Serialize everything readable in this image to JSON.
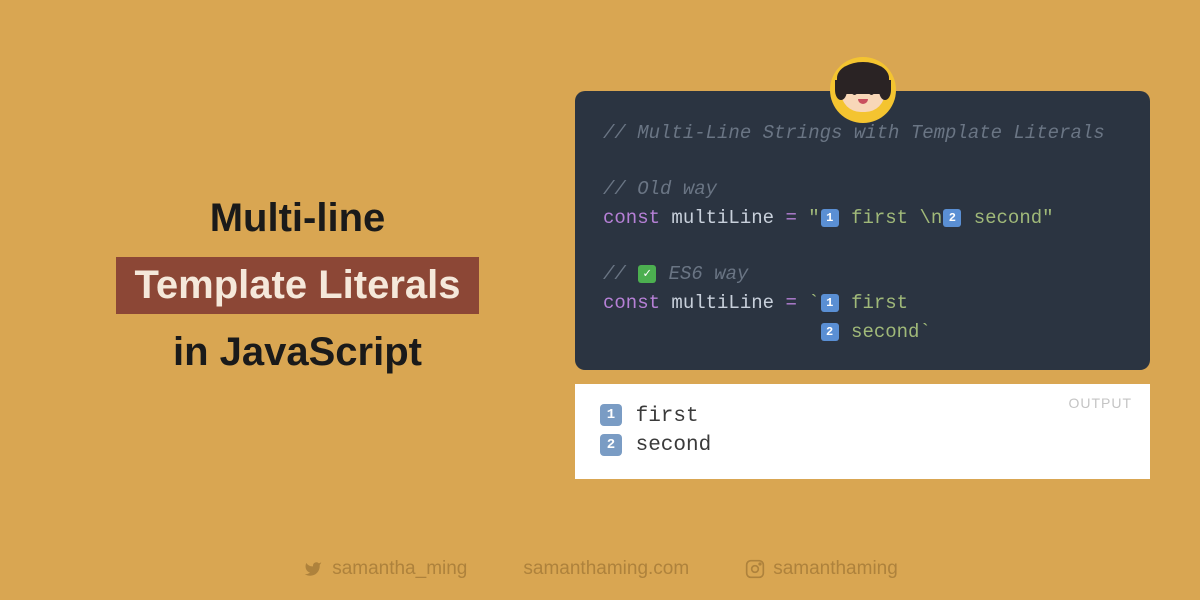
{
  "title": {
    "line1": "Multi-line",
    "highlight": "Template Literals",
    "line3": "in JavaScript"
  },
  "code": {
    "comment1": "// Multi-Line Strings with Template Literals",
    "comment2": "// Old way",
    "keyword": "const",
    "varname": "multiLine",
    "equals": "=",
    "string_open_dq": "\"",
    "string_first": " first ",
    "string_newline": "\\n",
    "string_second": " second",
    "string_close_dq": "\"",
    "comment3_prefix": "// ",
    "comment3_suffix": "  ES6 way",
    "string_open_bt": "`",
    "bt_first": " first",
    "bt_second_indent": "                   ",
    "bt_second": " second",
    "string_close_bt": "`",
    "num1": "1",
    "num2": "2",
    "check": "✓"
  },
  "output": {
    "label": "OUTPUT",
    "line1": " first",
    "line2": " second",
    "num1": "1",
    "num2": "2"
  },
  "footer": {
    "twitter": "samantha_ming",
    "website": "samanthaming.com",
    "instagram": "samanthaming"
  }
}
